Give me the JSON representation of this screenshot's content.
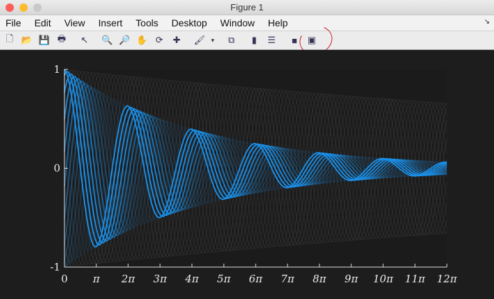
{
  "window": {
    "title": "Figure 1"
  },
  "menu": [
    "File",
    "Edit",
    "View",
    "Insert",
    "Tools",
    "Desktop",
    "Window",
    "Help"
  ],
  "toolbar": [
    {
      "icon": "new-figure-icon",
      "glyph": "🗋"
    },
    {
      "icon": "open-file-icon",
      "glyph": "📂"
    },
    {
      "icon": "save-icon",
      "glyph": "💾"
    },
    {
      "icon": "print-icon",
      "glyph": "🖶"
    },
    {
      "icon": "pointer-icon",
      "glyph": "↖"
    },
    {
      "icon": "zoom-in-icon",
      "glyph": "🔍"
    },
    {
      "icon": "zoom-out-icon",
      "glyph": "🔎"
    },
    {
      "icon": "pan-icon",
      "glyph": "✋"
    },
    {
      "icon": "rotate-3d-icon",
      "glyph": "⟳"
    },
    {
      "icon": "data-cursor-icon",
      "glyph": "✚"
    },
    {
      "icon": "brush-icon",
      "glyph": "🖌"
    },
    {
      "icon": "brush-dropdown-icon",
      "glyph": "▾"
    },
    {
      "icon": "link-plot-icon",
      "glyph": "⧉"
    },
    {
      "icon": "colorbar-icon",
      "glyph": "▮"
    },
    {
      "icon": "legend-icon",
      "glyph": "☰"
    },
    {
      "icon": "hide-plot-tools-icon",
      "glyph": "■"
    },
    {
      "icon": "show-plot-tools-icon",
      "glyph": "▣"
    }
  ],
  "colors": {
    "accent": "#1a8fe8",
    "background": "#1d1d1d",
    "axis": "#e0e0e0",
    "annotation": "#c8202a"
  },
  "chart_data": {
    "type": "line",
    "title": "",
    "xlabel": "",
    "ylabel": "",
    "xlim": [
      0,
      37.699
    ],
    "ylim": [
      -1,
      1
    ],
    "xticks": [
      0,
      3.1416,
      6.2832,
      9.4248,
      12.566,
      15.708,
      18.85,
      21.991,
      25.133,
      28.274,
      31.416,
      34.558,
      37.699
    ],
    "xticklabels": [
      "0",
      "π",
      "2π",
      "3π",
      "4π",
      "5π",
      "6π",
      "7π",
      "8π",
      "9π",
      "10π",
      "11π",
      "12π"
    ],
    "yticks": [
      -1,
      0,
      1
    ],
    "yticklabels": [
      "-1",
      "0",
      "1"
    ],
    "grid": false,
    "function": "y = cos(x - phase) * exp(-decay * x)",
    "decay": 0.074,
    "series_phases": [
      0,
      0.35,
      0.7,
      1.05,
      1.4,
      1.75,
      2.1,
      2.45,
      2.8,
      3.15,
      3.5,
      3.85,
      4.2,
      4.55,
      4.9,
      5.25,
      5.6,
      5.95
    ],
    "series_opacity": [
      1,
      1,
      0.95,
      0.85,
      0.7,
      0.55,
      0.42,
      0.32,
      0.24,
      0.18,
      0.14,
      0.11,
      0.09,
      0.08,
      0.07,
      0.06,
      0.06,
      0.05
    ]
  }
}
